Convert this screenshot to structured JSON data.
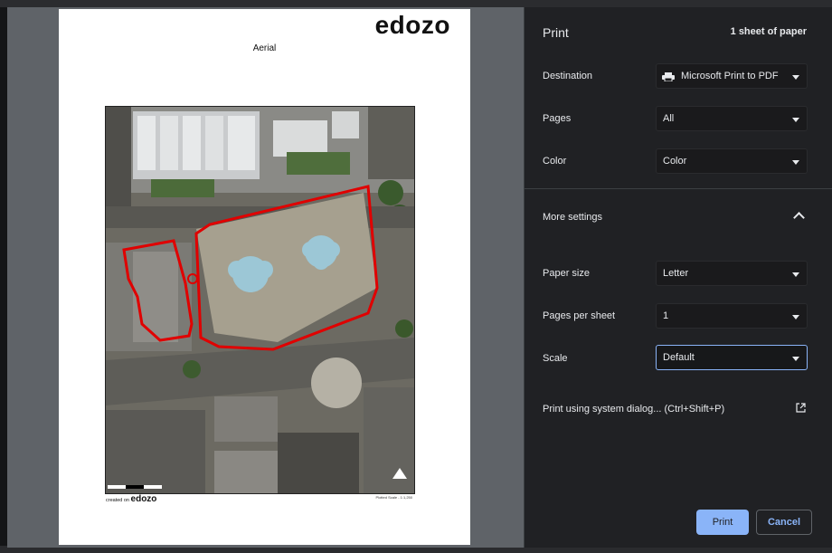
{
  "preview": {
    "logo_text": "edozo",
    "doc_title": "Aerial",
    "created_prefix": "created on",
    "created_brand": "edozo",
    "plotted_scale": "Plotted Scale - 1:1,250"
  },
  "panel": {
    "title": "Print",
    "sheet_count": "1 sheet of paper",
    "destination": {
      "label": "Destination",
      "value": "Microsoft Print to PDF"
    },
    "pages": {
      "label": "Pages",
      "value": "All"
    },
    "color": {
      "label": "Color",
      "value": "Color"
    },
    "more_settings": "More settings",
    "paper_size": {
      "label": "Paper size",
      "value": "Letter"
    },
    "pages_per_sheet": {
      "label": "Pages per sheet",
      "value": "1"
    },
    "scale": {
      "label": "Scale",
      "value": "Default"
    },
    "system_dialog": "Print using system dialog... (Ctrl+Shift+P)",
    "print_button": "Print",
    "cancel_button": "Cancel"
  },
  "colors": {
    "accent": "#8ab4f8",
    "panel_bg": "#202124",
    "boundary_red": "#e00000"
  },
  "icons": [
    "printer-icon",
    "chevron-down-icon",
    "chevron-up-icon",
    "external-link-icon",
    "north-arrow-icon"
  ]
}
